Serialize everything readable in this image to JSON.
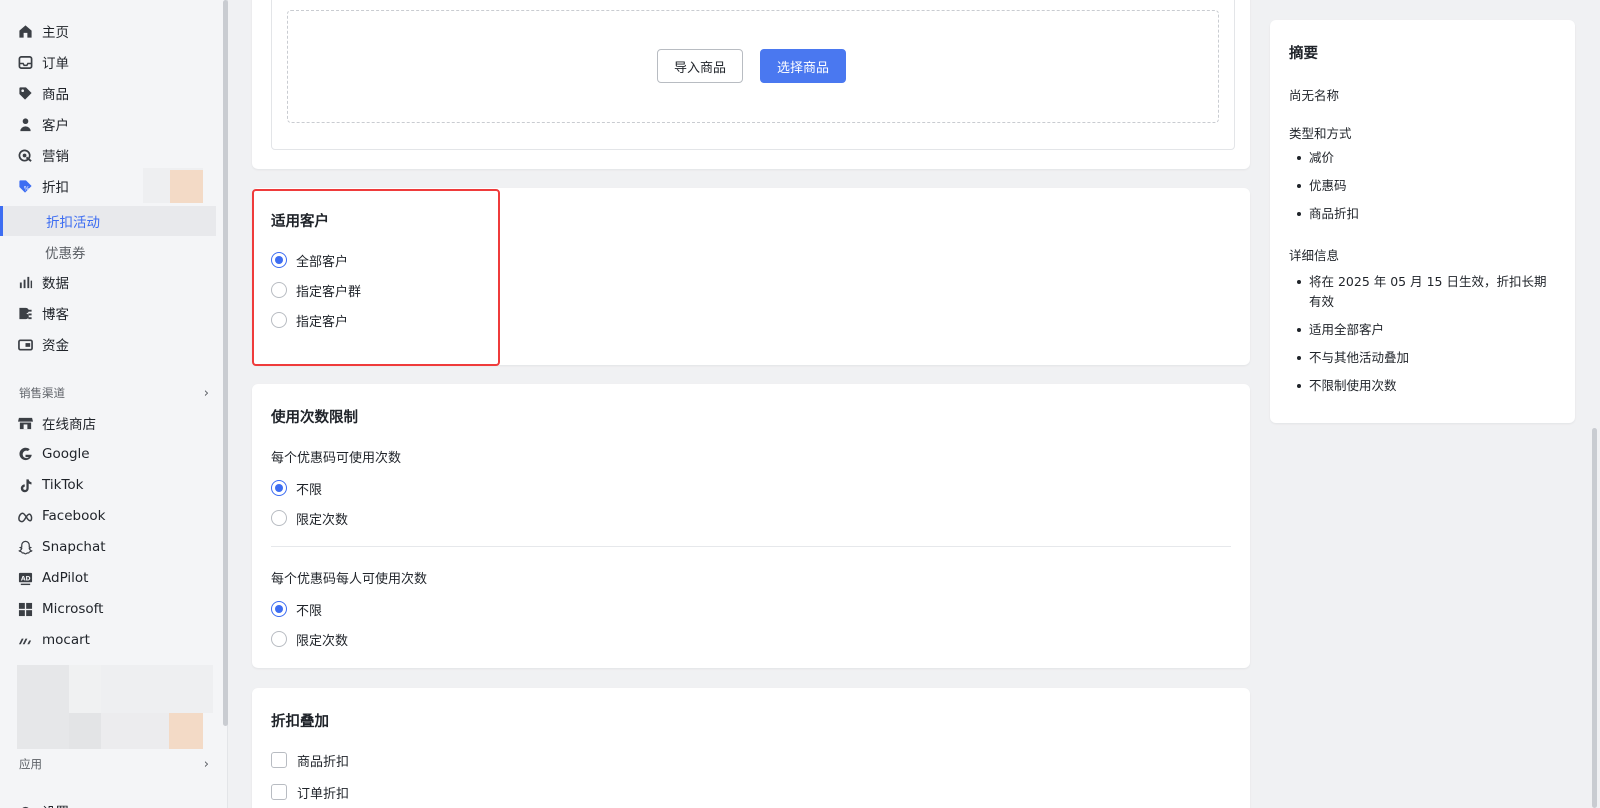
{
  "sidebar": {
    "items": [
      {
        "label": "主页",
        "icon": "home-icon"
      },
      {
        "label": "订单",
        "icon": "inbox-icon"
      },
      {
        "label": "商品",
        "icon": "tag-icon"
      },
      {
        "label": "客户",
        "icon": "person-icon"
      },
      {
        "label": "营销",
        "icon": "target-icon"
      },
      {
        "label": "折扣",
        "icon": "discount-icon"
      }
    ],
    "sub_items": [
      {
        "label": "折扣活动",
        "active": true
      },
      {
        "label": "优惠券",
        "active": false
      }
    ],
    "items2": [
      {
        "label": "数据",
        "icon": "bar-chart-icon"
      },
      {
        "label": "博客",
        "icon": "blog-icon"
      },
      {
        "label": "资金",
        "icon": "wallet-icon"
      }
    ],
    "sales_channel_label": "销售渠道",
    "channels": [
      {
        "label": "在线商店",
        "icon": "store-icon"
      },
      {
        "label": "Google",
        "icon": "google-icon"
      },
      {
        "label": "TikTok",
        "icon": "tiktok-icon"
      },
      {
        "label": "Facebook",
        "icon": "meta-icon"
      },
      {
        "label": "Snapchat",
        "icon": "snapchat-icon"
      },
      {
        "label": "AdPilot",
        "icon": "ad-icon"
      },
      {
        "label": "Microsoft",
        "icon": "microsoft-icon"
      },
      {
        "label": "mocart",
        "icon": "mocart-icon"
      }
    ],
    "apps_label": "应用",
    "settings_label": "设置"
  },
  "products_card": {
    "import_label": "导入商品",
    "select_label": "选择商品"
  },
  "customers_card": {
    "title": "适用客户",
    "options": [
      "全部客户",
      "指定客户群",
      "指定客户"
    ],
    "selected": 0
  },
  "usage_card": {
    "title": "使用次数限制",
    "group1_label": "每个优惠码可使用次数",
    "group1_options": [
      "不限",
      "限定次数"
    ],
    "group2_label": "每个优惠码每人可使用次数",
    "group2_options": [
      "不限",
      "限定次数"
    ]
  },
  "stacking_card": {
    "title": "折扣叠加",
    "options": [
      "商品折扣",
      "订单折扣"
    ]
  },
  "summary": {
    "title": "摘要",
    "name": "尚无名称",
    "type_heading": "类型和方式",
    "type_items": [
      "减价",
      "优惠码",
      "商品折扣"
    ],
    "detail_heading": "详细信息",
    "detail_items": [
      "将在 2025 年 05 月 15 日生效，折扣长期有效",
      "适用全部客户",
      "不与其他活动叠加",
      "不限制使用次数"
    ]
  },
  "colors": {
    "accent": "#3d6df2",
    "highlight": "#ef3b3b"
  }
}
